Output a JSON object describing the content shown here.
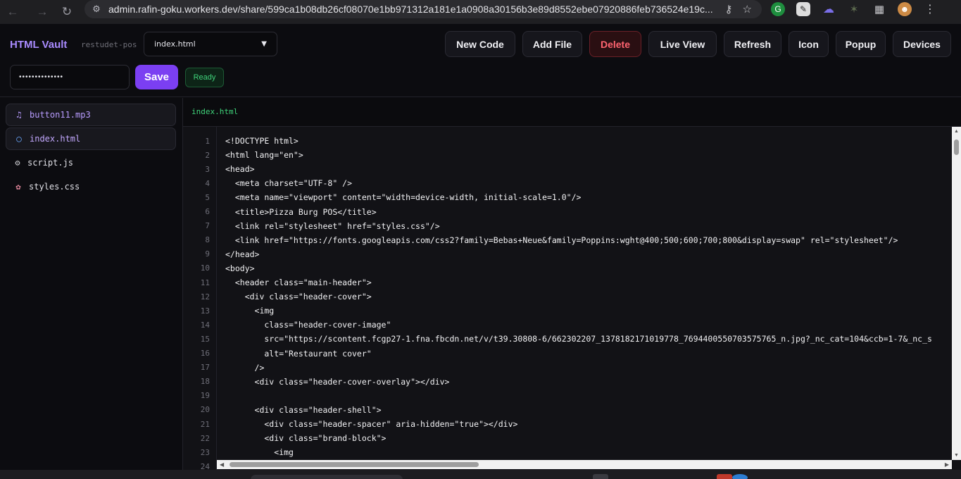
{
  "browser": {
    "url": "admin.rafin-goku.workers.dev/share/599ca1b08db26cf08070e1bb971312a181e1a0908a30156b3e89d8552ebe07920886feb736524e19c...",
    "icons": [
      "back-icon",
      "forward-icon",
      "reload-icon",
      "site-settings-icon",
      "key-icon",
      "star-icon",
      "extensions-icon",
      "profile-avatar",
      "menu-icon"
    ]
  },
  "header": {
    "title": "HTML Vault",
    "subtitle": "restudet-pos",
    "file_select": {
      "selected": "index.html"
    },
    "toolbar": {
      "new_code": "New Code",
      "add_file": "Add File",
      "delete": "Delete",
      "live_view": "Live View",
      "refresh": "Refresh",
      "icon": "Icon",
      "popup": "Popup",
      "devices": "Devices"
    },
    "password_value": "••••••••••••••",
    "save_label": "Save",
    "status": "Ready"
  },
  "sidebar": {
    "files": [
      {
        "name": "button11.mp3",
        "icon": "music-note-icon",
        "boxed": true
      },
      {
        "name": "index.html",
        "icon": "globe-icon",
        "boxed": true,
        "active": true
      },
      {
        "name": "script.js",
        "icon": "gear-icon",
        "boxed": false
      },
      {
        "name": "styles.css",
        "icon": "palette-icon",
        "boxed": false
      }
    ]
  },
  "editor": {
    "tab": "index.html",
    "lines": [
      {
        "n": "1",
        "text": "<!DOCTYPE html>"
      },
      {
        "n": "2",
        "text": "<html lang=\"en\">"
      },
      {
        "n": "3",
        "text": "<head>"
      },
      {
        "n": "4",
        "text": "  <meta charset=\"UTF-8\" />"
      },
      {
        "n": "5",
        "text": "  <meta name=\"viewport\" content=\"width=device-width, initial-scale=1.0\"/>"
      },
      {
        "n": "6",
        "text": "  <title>Pizza Burg POS</title>"
      },
      {
        "n": "7",
        "text": "  <link rel=\"stylesheet\" href=\"styles.css\"/>"
      },
      {
        "n": "8",
        "text": "  <link href=\"https://fonts.googleapis.com/css2?family=Bebas+Neue&family=Poppins:wght@400;500;600;700;800&display=swap\" rel=\"stylesheet\"/>"
      },
      {
        "n": "9",
        "text": "</head>"
      },
      {
        "n": "10",
        "text": "<body>"
      },
      {
        "n": "11",
        "text": "  <header class=\"main-header\">"
      },
      {
        "n": "12",
        "text": "    <div class=\"header-cover\">"
      },
      {
        "n": "13",
        "text": "      <img"
      },
      {
        "n": "14",
        "text": "        class=\"header-cover-image\""
      },
      {
        "n": "15",
        "text": "        src=\"https://scontent.fcgp27-1.fna.fbcdn.net/v/t39.30808-6/662302207_1378182171019778_7694400550703575765_n.jpg?_nc_cat=104&ccb=1-7&_nc_s"
      },
      {
        "n": "16",
        "text": "        alt=\"Restaurant cover\""
      },
      {
        "n": "17",
        "text": "      />"
      },
      {
        "n": "18",
        "text": "      <div class=\"header-cover-overlay\"></div>"
      },
      {
        "n": "19",
        "text": ""
      },
      {
        "n": "20",
        "text": "      <div class=\"header-shell\">"
      },
      {
        "n": "21",
        "text": "        <div class=\"header-spacer\" aria-hidden=\"true\"></div>"
      },
      {
        "n": "22",
        "text": "        <div class=\"brand-block\">"
      },
      {
        "n": "23",
        "text": "          <img"
      },
      {
        "n": "24",
        "text": ""
      }
    ]
  }
}
